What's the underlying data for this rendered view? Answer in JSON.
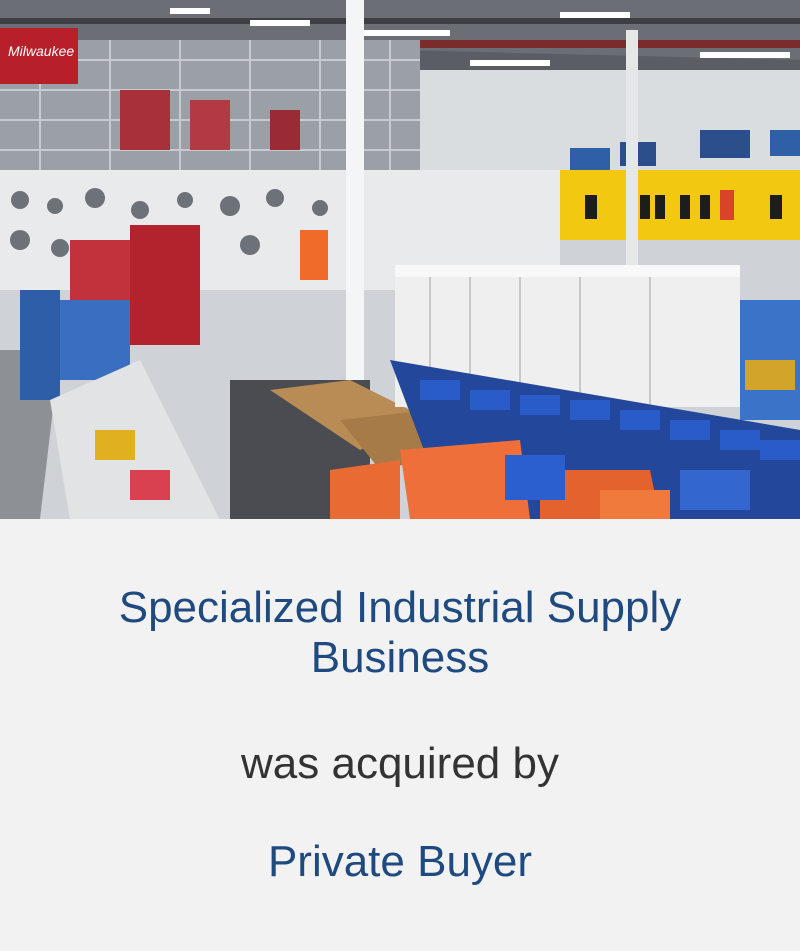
{
  "deal": {
    "company_name": "Specialized Industrial Supply Business",
    "action_text": "was acquired by",
    "buyer_name": "Private Buyer"
  },
  "photo": {
    "subject": "industrial-supply-store-interior",
    "sign_text": "Milwaukee"
  },
  "colors": {
    "background": "#f2f2f2",
    "accent_text": "#1f4a80",
    "body_text": "#333333"
  }
}
